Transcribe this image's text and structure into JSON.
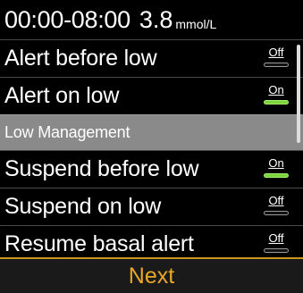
{
  "header": {
    "time_range": "00:00-08:00",
    "value": "3.8",
    "unit": "mmol/L"
  },
  "rows": [
    {
      "label": "Alert before low",
      "toggle": "Off",
      "enabled": false
    },
    {
      "label": "Alert on low",
      "toggle": "On",
      "enabled": true
    },
    {
      "label": "Low Management",
      "section": true
    },
    {
      "label": "Suspend before low",
      "toggle": "On",
      "enabled": true
    },
    {
      "label": "Suspend on low",
      "toggle": "Off",
      "enabled": false
    },
    {
      "label": "Resume basal alert",
      "toggle": "Off",
      "enabled": false
    }
  ],
  "footer": {
    "next_label": "Next"
  },
  "colors": {
    "on_track": "#7bd33a",
    "next_text": "#e9a72a",
    "section_bg": "#8a8a8a"
  }
}
